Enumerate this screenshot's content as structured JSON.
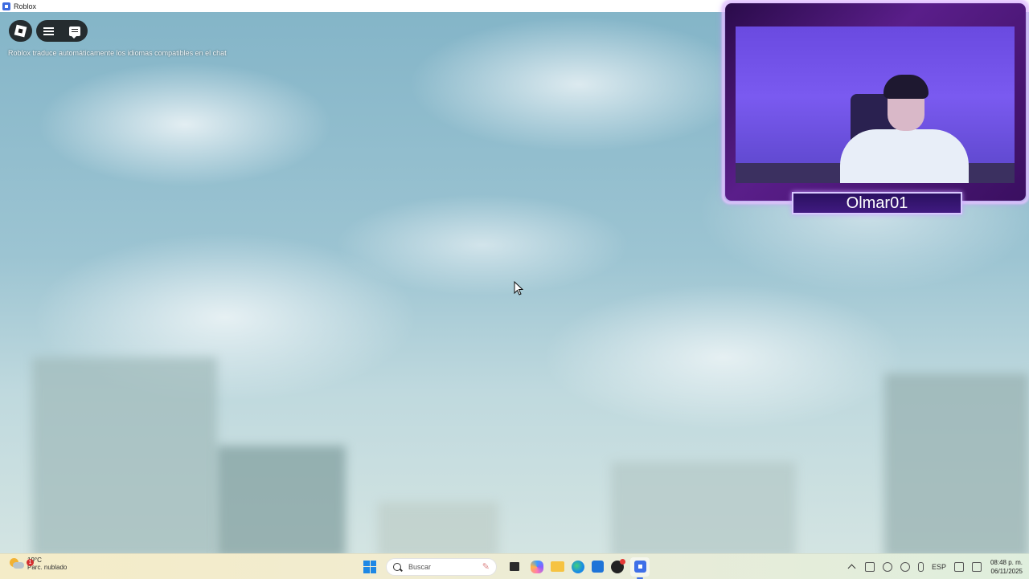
{
  "window": {
    "title": "Roblox"
  },
  "game": {
    "translation_notice": "Roblox traduce automáticamente los idiomas compatibles en el chat"
  },
  "webcam": {
    "streamer_name": "Olmar01"
  },
  "taskbar": {
    "weather": {
      "temperature": "19°C",
      "condition": "Parc. nublado",
      "badge": "1"
    },
    "search_placeholder": "Buscar",
    "language": "ESP",
    "time": "08:48 p. m.",
    "date": "06/11/2025"
  },
  "colors": {
    "roblox_blue": "#3f6fe8",
    "overlay_purple": "#5a1e8a",
    "taskbar_bg": "#f2eccf"
  }
}
